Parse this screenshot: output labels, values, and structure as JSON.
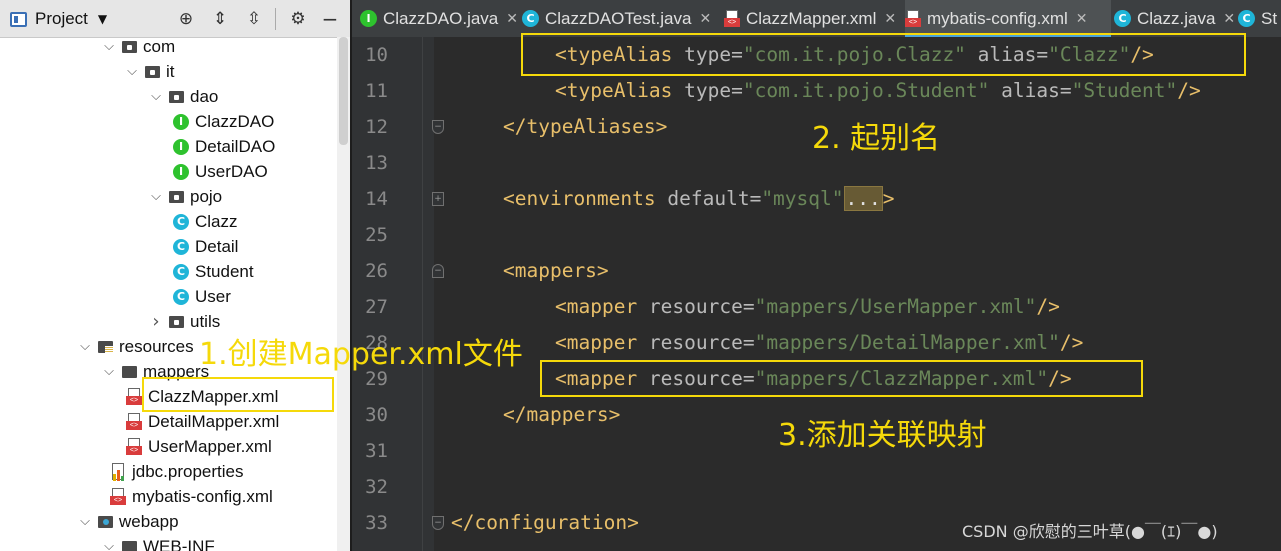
{
  "project_panel": {
    "title": "Project",
    "tree": [
      {
        "label": "com",
        "icon": "package-folder-icon",
        "expanded": true
      },
      {
        "label": "it",
        "icon": "package-folder-icon",
        "expanded": true
      },
      {
        "label": "dao",
        "icon": "package-folder-icon",
        "expanded": true
      },
      {
        "label": "ClazzDAO",
        "icon": "interface-icon"
      },
      {
        "label": "DetailDAO",
        "icon": "interface-icon"
      },
      {
        "label": "UserDAO",
        "icon": "interface-icon"
      },
      {
        "label": "pojo",
        "icon": "package-folder-icon",
        "expanded": true
      },
      {
        "label": "Clazz",
        "icon": "class-icon"
      },
      {
        "label": "Detail",
        "icon": "class-icon"
      },
      {
        "label": "Student",
        "icon": "class-icon"
      },
      {
        "label": "User",
        "icon": "class-icon"
      },
      {
        "label": "utils",
        "icon": "package-folder-icon",
        "expanded": false
      },
      {
        "label": "resources",
        "icon": "resources-folder-icon",
        "expanded": true
      },
      {
        "label": "mappers",
        "icon": "folder-icon",
        "expanded": true
      },
      {
        "label": "ClazzMapper.xml",
        "icon": "xml-file-icon",
        "selected": true
      },
      {
        "label": "DetailMapper.xml",
        "icon": "xml-file-icon"
      },
      {
        "label": "UserMapper.xml",
        "icon": "xml-file-icon"
      },
      {
        "label": "jdbc.properties",
        "icon": "properties-file-icon"
      },
      {
        "label": "mybatis-config.xml",
        "icon": "xml-file-icon"
      },
      {
        "label": "webapp",
        "icon": "web-folder-icon",
        "expanded": true
      },
      {
        "label": "WEB-INF",
        "icon": "folder-icon",
        "expanded": true
      }
    ]
  },
  "tabs": [
    {
      "label": "ClazzDAO.java",
      "icon": "interface-icon"
    },
    {
      "label": "ClazzDAOTest.java",
      "icon": "class-icon"
    },
    {
      "label": "ClazzMapper.xml",
      "icon": "xml-file-icon"
    },
    {
      "label": "mybatis-config.xml",
      "icon": "xml-file-icon",
      "active": true
    },
    {
      "label": "Clazz.java",
      "icon": "class-icon"
    },
    {
      "label": "St",
      "icon": "class-icon"
    }
  ],
  "code_lines": [
    {
      "num": "10",
      "parts": [
        [
          "t",
          "<typeAlias "
        ],
        [
          "a",
          "type"
        ],
        [
          "e",
          "="
        ],
        [
          "v",
          "\"com.it.pojo.Clazz\""
        ],
        [
          "t",
          " "
        ],
        [
          "a",
          "alias"
        ],
        [
          "e",
          "="
        ],
        [
          "v",
          "\"Clazz\""
        ],
        [
          "t",
          "/>"
        ]
      ]
    },
    {
      "num": "11",
      "parts": [
        [
          "t",
          "<typeAlias "
        ],
        [
          "a",
          "type"
        ],
        [
          "e",
          "="
        ],
        [
          "v",
          "\"com.it.pojo.Student\""
        ],
        [
          "t",
          " "
        ],
        [
          "a",
          "alias"
        ],
        [
          "e",
          "="
        ],
        [
          "v",
          "\"Student\""
        ],
        [
          "t",
          "/>"
        ]
      ]
    },
    {
      "num": "12",
      "parts": [
        [
          "t",
          "</typeAliases>"
        ]
      ]
    },
    {
      "num": "13",
      "parts": []
    },
    {
      "num": "14",
      "parts": [
        [
          "t",
          "<environments "
        ],
        [
          "a",
          "default"
        ],
        [
          "e",
          "="
        ],
        [
          "v",
          "\"mysql\""
        ],
        [
          "c",
          "..."
        ],
        [
          "t",
          ">"
        ]
      ]
    },
    {
      "num": "25",
      "parts": []
    },
    {
      "num": "26",
      "parts": [
        [
          "t",
          "<mappers>"
        ]
      ]
    },
    {
      "num": "27",
      "parts": [
        [
          "t",
          "<mapper "
        ],
        [
          "a",
          "resource"
        ],
        [
          "e",
          "="
        ],
        [
          "v",
          "\"mappers/UserMapper.xml\""
        ],
        [
          "t",
          "/>"
        ]
      ]
    },
    {
      "num": "28",
      "parts": [
        [
          "t",
          "<mapper "
        ],
        [
          "a",
          "resource"
        ],
        [
          "e",
          "="
        ],
        [
          "v",
          "\"mappers/DetailMapper.xml\""
        ],
        [
          "t",
          "/>"
        ]
      ]
    },
    {
      "num": "29",
      "parts": [
        [
          "t",
          "<mapper "
        ],
        [
          "a",
          "resource"
        ],
        [
          "e",
          "="
        ],
        [
          "v",
          "\"mappers/ClazzMapper.xml\""
        ],
        [
          "t",
          "/>"
        ]
      ]
    },
    {
      "num": "30",
      "parts": [
        [
          "t",
          "</mappers>"
        ]
      ]
    },
    {
      "num": "31",
      "parts": []
    },
    {
      "num": "32",
      "parts": []
    },
    {
      "num": "33",
      "parts": [
        [
          "t",
          "</configuration>"
        ]
      ]
    }
  ],
  "annotations": {
    "step1": "1.创建Mapper.xml文件",
    "step2": "2. 起别名",
    "step3": "3.添加关联映射"
  },
  "watermark": "CSDN @欣慰的三叶草(●￣(ｴ)￣●)",
  "colors": {
    "annotation": "#f5d90a",
    "xml_tag": "#e8bf6a",
    "xml_attr": "#bababa",
    "xml_value": "#6a8759",
    "interface_icon": "#2ec22e",
    "class_icon": "#1fb5d8"
  }
}
